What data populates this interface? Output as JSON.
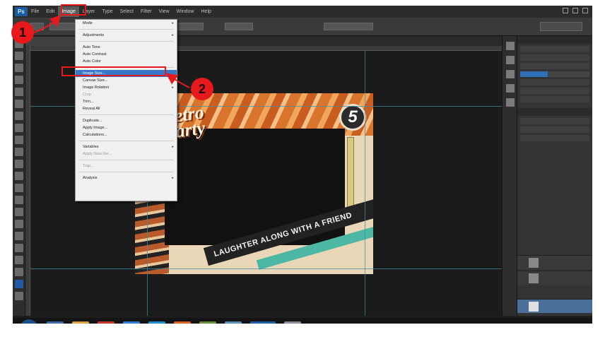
{
  "app": {
    "logo_text": "Ps"
  },
  "menubar": {
    "items": [
      "File",
      "Edit",
      "Image",
      "Layer",
      "Type",
      "Select",
      "Filter",
      "View",
      "Window",
      "Help"
    ],
    "active_index": 2
  },
  "document": {
    "title_line1": "Retro",
    "title_line2": "Party",
    "badge_number": "5",
    "banner_text": "LAUGHTER ALONG WITH A FRIEND"
  },
  "image_menu": {
    "items": [
      {
        "label": "Mode",
        "type": "submenu"
      },
      {
        "type": "separator"
      },
      {
        "label": "Adjustments",
        "type": "submenu"
      },
      {
        "type": "separator"
      },
      {
        "label": "Auto Tone",
        "type": "item"
      },
      {
        "label": "Auto Contrast",
        "type": "item"
      },
      {
        "label": "Auto Color",
        "type": "item"
      },
      {
        "type": "separator"
      },
      {
        "label": "Image Size...",
        "type": "item",
        "highlighted": true
      },
      {
        "label": "Canvas Size...",
        "type": "item"
      },
      {
        "label": "Image Rotation",
        "type": "submenu"
      },
      {
        "label": "Crop",
        "type": "item",
        "disabled": true
      },
      {
        "label": "Trim...",
        "type": "item"
      },
      {
        "label": "Reveal All",
        "type": "item"
      },
      {
        "type": "separator"
      },
      {
        "label": "Duplicate...",
        "type": "item"
      },
      {
        "label": "Apply Image...",
        "type": "item"
      },
      {
        "label": "Calculations...",
        "type": "item"
      },
      {
        "type": "separator"
      },
      {
        "label": "Variables",
        "type": "submenu"
      },
      {
        "label": "Apply Data Set...",
        "type": "item",
        "disabled": true
      },
      {
        "type": "separator"
      },
      {
        "label": "Trap...",
        "type": "item",
        "disabled": true
      },
      {
        "type": "separator"
      },
      {
        "label": "Analysis",
        "type": "submenu"
      }
    ]
  },
  "annotations": {
    "marker_1": "1",
    "marker_2": "2",
    "color": "#e8191d"
  },
  "colors": {
    "menu_highlight": "#3978c7",
    "guide": "#3f8fa8",
    "layer_selected": "#4a6f99"
  }
}
